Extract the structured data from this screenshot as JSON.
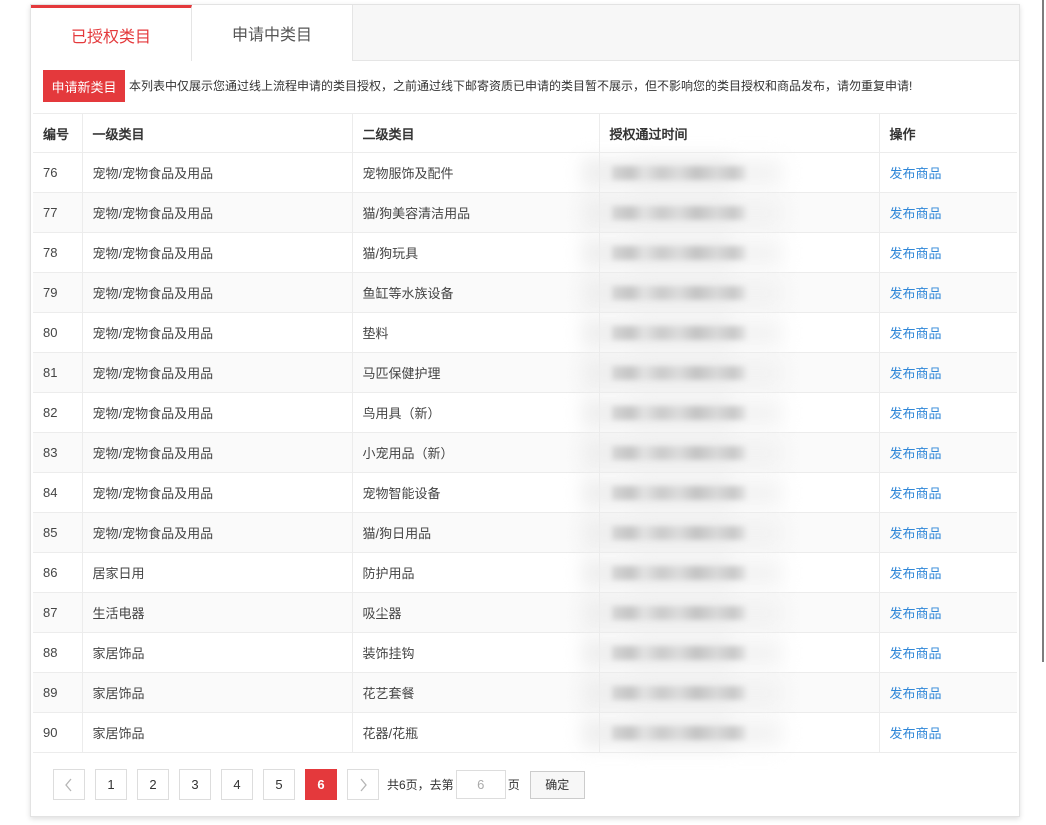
{
  "colors": {
    "accent": "#e4393c",
    "link": "#2f87d8"
  },
  "tabs": {
    "active_index": 0,
    "items": [
      {
        "label": "已授权类目"
      },
      {
        "label": "申请中类目"
      }
    ]
  },
  "toolbar": {
    "apply_button_label": "申请新类目",
    "notice": "本列表中仅展示您通过线上流程申请的类目授权，之前通过线下邮寄资质已申请的类目暂不展示，但不影响您的类目授权和商品发布，请勿重复申请!"
  },
  "table": {
    "columns": [
      "编号",
      "一级类目",
      "二级类目",
      "授权通过时间",
      "操作"
    ],
    "rows": [
      {
        "id": "76",
        "level1": "宠物/宠物食品及用品",
        "level2": "宠物服饰及配件",
        "action": "发布商品"
      },
      {
        "id": "77",
        "level1": "宠物/宠物食品及用品",
        "level2": "猫/狗美容清洁用品",
        "action": "发布商品"
      },
      {
        "id": "78",
        "level1": "宠物/宠物食品及用品",
        "level2": "猫/狗玩具",
        "action": "发布商品"
      },
      {
        "id": "79",
        "level1": "宠物/宠物食品及用品",
        "level2": "鱼缸等水族设备",
        "action": "发布商品"
      },
      {
        "id": "80",
        "level1": "宠物/宠物食品及用品",
        "level2": "垫料",
        "action": "发布商品"
      },
      {
        "id": "81",
        "level1": "宠物/宠物食品及用品",
        "level2": "马匹保健护理",
        "action": "发布商品"
      },
      {
        "id": "82",
        "level1": "宠物/宠物食品及用品",
        "level2": "鸟用具（新）",
        "action": "发布商品"
      },
      {
        "id": "83",
        "level1": "宠物/宠物食品及用品",
        "level2": "小宠用品（新）",
        "action": "发布商品"
      },
      {
        "id": "84",
        "level1": "宠物/宠物食品及用品",
        "level2": "宠物智能设备",
        "action": "发布商品"
      },
      {
        "id": "85",
        "level1": "宠物/宠物食品及用品",
        "level2": "猫/狗日用品",
        "action": "发布商品"
      },
      {
        "id": "86",
        "level1": "居家日用",
        "level2": "防护用品",
        "action": "发布商品"
      },
      {
        "id": "87",
        "level1": "生活电器",
        "level2": "吸尘器",
        "action": "发布商品"
      },
      {
        "id": "88",
        "level1": "家居饰品",
        "level2": "装饰挂钩",
        "action": "发布商品"
      },
      {
        "id": "89",
        "level1": "家居饰品",
        "level2": "花艺套餐",
        "action": "发布商品"
      },
      {
        "id": "90",
        "level1": "家居饰品",
        "level2": "花器/花瓶",
        "action": "发布商品"
      }
    ]
  },
  "pagination": {
    "prev_icon": "chevron-left-icon",
    "next_icon": "chevron-right-icon",
    "pages": [
      "1",
      "2",
      "3",
      "4",
      "5",
      "6"
    ],
    "current_page": 6,
    "total_text": "共6页，去第",
    "goto_placeholder": "6",
    "page_suffix": "页",
    "confirm_label": "确定"
  }
}
